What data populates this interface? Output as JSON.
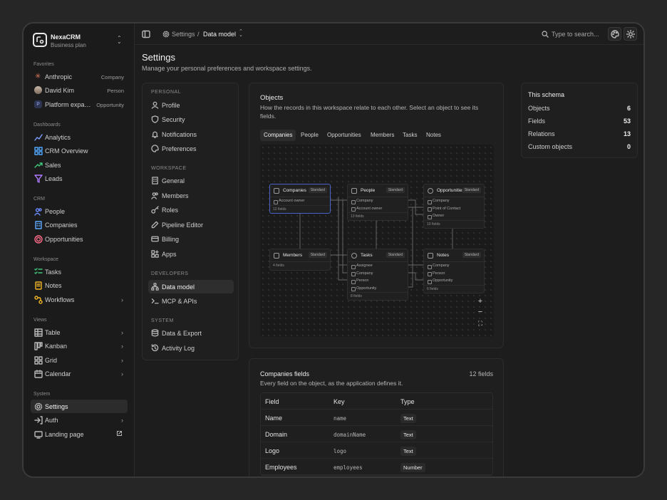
{
  "app": {
    "name": "NexaCRM",
    "plan": "Business plan"
  },
  "sidebar": {
    "sections": {
      "favorites": "Favorites",
      "dashboards": "Dashboards",
      "crm": "CRM",
      "workspace": "Workspace",
      "views": "Views",
      "system": "System"
    },
    "favorites": [
      {
        "label": "Anthropic",
        "tag": "Company"
      },
      {
        "label": "David Kim",
        "tag": "Person"
      },
      {
        "label": "Platform expa…",
        "tag": "Opportunity",
        "avatar": "P"
      }
    ],
    "dashboards": [
      "Analytics",
      "CRM Overview",
      "Sales",
      "Leads"
    ],
    "crm": [
      "People",
      "Companies",
      "Opportunities"
    ],
    "workspace": [
      "Tasks",
      "Notes",
      "Workflows"
    ],
    "views": [
      "Table",
      "Kanban",
      "Grid",
      "Calendar"
    ],
    "system": [
      "Settings",
      "Auth",
      "Landing page"
    ]
  },
  "topbar": {
    "crumb_settings": "Settings",
    "crumb_sep": "/",
    "crumb_current": "Data model",
    "search_placeholder": "Type to search..."
  },
  "page": {
    "title": "Settings",
    "subtitle": "Manage your personal preferences and workspace settings."
  },
  "settings_nav": {
    "personal_label": "PERSONAL",
    "personal": [
      "Profile",
      "Security",
      "Notifications",
      "Preferences"
    ],
    "workspace_label": "WORKSPACE",
    "workspace": [
      "General",
      "Members",
      "Roles",
      "Pipeline Editor",
      "Billing",
      "Apps"
    ],
    "developers_label": "DEVELOPERS",
    "developers": [
      "Data model",
      "MCP & APIs"
    ],
    "system_label": "SYSTEM",
    "system": [
      "Data & Export",
      "Activity Log"
    ]
  },
  "objects": {
    "title": "Objects",
    "description_line1": "How the records in this workspace relate to each other. Select an object to see its",
    "description_line2": "fields.",
    "tabs": [
      "Companies",
      "People",
      "Opportunities",
      "Members",
      "Tasks",
      "Notes"
    ],
    "nodes": [
      {
        "name": "Companies",
        "badge": "Standard",
        "fields": [
          "Account owner"
        ],
        "count": "12 fields"
      },
      {
        "name": "People",
        "badge": "Standard",
        "fields": [
          "Company",
          "Account owner"
        ],
        "count": "13 fields"
      },
      {
        "name": "Opportunities",
        "badge": "Standard",
        "fields": [
          "Company",
          "Point of Contact",
          "Owner"
        ],
        "count": "10 fields"
      },
      {
        "name": "Members",
        "badge": "Standard",
        "fields": [],
        "count": "4 fields"
      },
      {
        "name": "Tasks",
        "badge": "Standard",
        "fields": [
          "Assignee",
          "Company",
          "Person",
          "Opportunity"
        ],
        "count": "8 fields"
      },
      {
        "name": "Notes",
        "badge": "Standard",
        "fields": [
          "Company",
          "Person",
          "Opportunity"
        ],
        "count": "6 fields"
      }
    ],
    "zoom_in": "+",
    "zoom_out": "−",
    "fit": "⛶"
  },
  "schema": {
    "title": "This schema",
    "rows": [
      {
        "label": "Objects",
        "value": "6"
      },
      {
        "label": "Fields",
        "value": "53"
      },
      {
        "label": "Relations",
        "value": "13"
      },
      {
        "label": "Custom objects",
        "value": "0"
      }
    ]
  },
  "fields_table": {
    "title": "Companies fields",
    "count": "12 fields",
    "description": "Every field on the object, as the application defines it.",
    "headers": [
      "Field",
      "Key",
      "Type"
    ],
    "rows": [
      [
        "Name",
        "name",
        "Text"
      ],
      [
        "Domain",
        "domainName",
        "Text"
      ],
      [
        "Logo",
        "logo",
        "Text"
      ],
      [
        "Employees",
        "employees",
        "Number"
      ]
    ]
  }
}
